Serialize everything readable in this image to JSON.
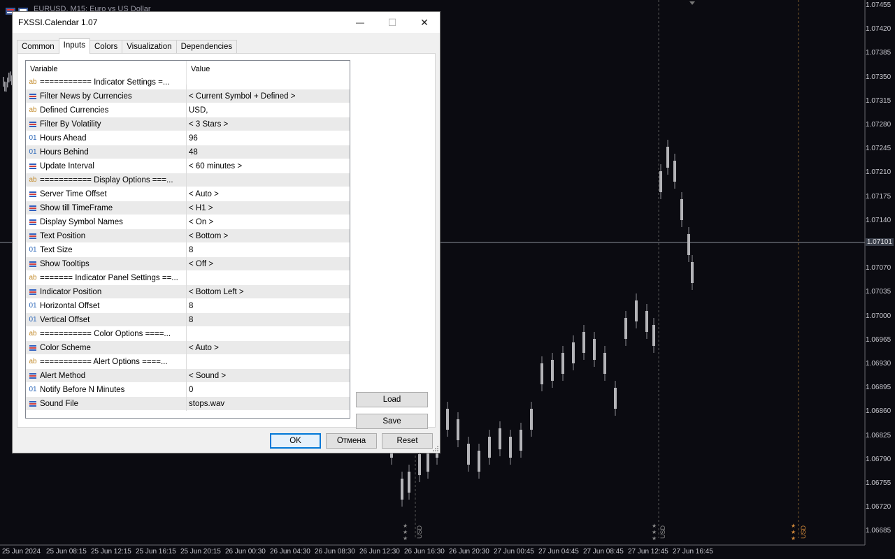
{
  "chart": {
    "title": "EURUSD, M15:  Euro vs US Dollar",
    "price_labels": [
      "1.07455",
      "1.07420",
      "1.07385",
      "1.07350",
      "1.07315",
      "1.07280",
      "1.07245",
      "1.07210",
      "1.07175",
      "1.07140",
      "1.07070",
      "1.07035",
      "1.07000",
      "1.06965",
      "1.06930",
      "1.06895",
      "1.06860",
      "1.06825",
      "1.06790",
      "1.06755",
      "1.06720",
      "1.06685"
    ],
    "current_price": "1.07101",
    "time_labels": [
      "25 Jun 2024",
      "25 Jun 08:15",
      "25 Jun 12:15",
      "25 Jun 16:15",
      "25 Jun 20:15",
      "26 Jun 00:30",
      "26 Jun 04:30",
      "26 Jun 08:30",
      "26 Jun 12:30",
      "26 Jun 16:30",
      "26 Jun 20:30",
      "27 Jun 00:45",
      "27 Jun 04:45",
      "27 Jun 08:45",
      "27 Jun 12:45",
      "27 Jun 16:45"
    ],
    "event_marker_text": "USD",
    "colors": {
      "background": "#0b0b11",
      "candle": "#b4b4b8",
      "grid": "#2a2a30",
      "event_high": "#d0883a"
    }
  },
  "dialog": {
    "title": "FXSSI.Calendar 1.07",
    "window_controls": {
      "minimize": "—",
      "maximize": "☐",
      "close": "✕"
    },
    "tabs": [
      {
        "label": "Common",
        "active": false
      },
      {
        "label": "Inputs",
        "active": true
      },
      {
        "label": "Colors",
        "active": false
      },
      {
        "label": "Visualization",
        "active": false
      },
      {
        "label": "Dependencies",
        "active": false
      }
    ],
    "grid": {
      "col_variable": "Variable",
      "col_value": "Value",
      "rows": [
        {
          "type": "ab",
          "variable": "=========== Indicator Settings =...",
          "value": ""
        },
        {
          "type": "list",
          "variable": "Filter News by Currencies",
          "value": "< Current Symbol + Defined >"
        },
        {
          "type": "ab",
          "variable": "Defined Currencies",
          "value": "USD,"
        },
        {
          "type": "list",
          "variable": "Filter By Volatility",
          "value": "< 3 Stars >"
        },
        {
          "type": "num",
          "variable": "Hours Ahead",
          "value": "96"
        },
        {
          "type": "num",
          "variable": "Hours Behind",
          "value": "48"
        },
        {
          "type": "list",
          "variable": "Update Interval",
          "value": "< 60 minutes >"
        },
        {
          "type": "ab",
          "variable": "=========== Display Options ===...",
          "value": ""
        },
        {
          "type": "list",
          "variable": "Server Time Offset",
          "value": "< Auto >"
        },
        {
          "type": "list",
          "variable": "Show till TimeFrame",
          "value": "< H1 >"
        },
        {
          "type": "list",
          "variable": "Display Symbol Names",
          "value": "< On >"
        },
        {
          "type": "list",
          "variable": "Text Position",
          "value": "< Bottom >"
        },
        {
          "type": "num",
          "variable": "Text Size",
          "value": "8"
        },
        {
          "type": "list",
          "variable": "Show Tooltips",
          "value": "< Off >"
        },
        {
          "type": "ab",
          "variable": "======= Indicator Panel Settings ==...",
          "value": ""
        },
        {
          "type": "list",
          "variable": "Indicator Position",
          "value": "< Bottom Left >"
        },
        {
          "type": "num",
          "variable": "Horizontal Offset",
          "value": "8"
        },
        {
          "type": "num",
          "variable": "Vertical Offset",
          "value": "8"
        },
        {
          "type": "ab",
          "variable": "=========== Color Options ====...",
          "value": ""
        },
        {
          "type": "list",
          "variable": "Color Scheme",
          "value": "< Auto >"
        },
        {
          "type": "ab",
          "variable": "=========== Alert Options ====...",
          "value": ""
        },
        {
          "type": "list",
          "variable": "Alert Method",
          "value": "< Sound >"
        },
        {
          "type": "num",
          "variable": "Notify Before N Minutes",
          "value": "0"
        },
        {
          "type": "list",
          "variable": "Sound File",
          "value": "stops.wav"
        }
      ]
    },
    "buttons": {
      "load": "Load",
      "save": "Save",
      "ok": "OK",
      "cancel": "Отмена",
      "reset": "Reset"
    },
    "icon_glyphs": {
      "ab": "ab",
      "num": "01"
    }
  }
}
